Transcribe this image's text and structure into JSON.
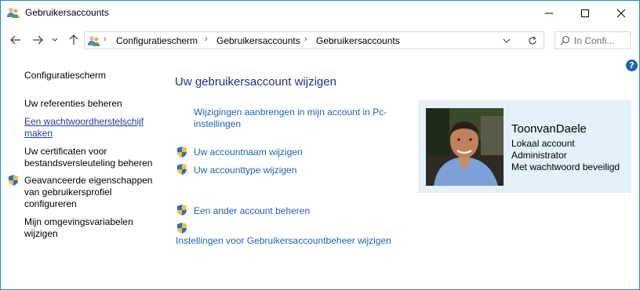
{
  "window": {
    "title": "Gebruikersaccounts"
  },
  "address_bar": {
    "breadcrumbs": [
      "Configuratiescherm",
      "Gebruikersaccounts",
      "Gebruikersaccounts"
    ],
    "search_placeholder": "In Confi..."
  },
  "sidebar": {
    "items": [
      {
        "label": "Configuratiescherm"
      },
      {
        "label": "Uw referenties beheren"
      },
      {
        "label": "Een wachtwoordherstelschijf maken"
      },
      {
        "label": "Uw certificaten voor bestandsversleuteling beheren"
      },
      {
        "label": "Geavanceerde eigenschappen van gebruikersprofiel configureren"
      },
      {
        "label": "Mijn omgevingsvariabelen wijzigen"
      }
    ]
  },
  "main": {
    "title": "Uw gebruikersaccount wijzigen",
    "links": [
      {
        "label": "Wijzigingen aanbrengen in mijn account in Pc-instellingen"
      },
      {
        "label": "Uw accountnaam wijzigen"
      },
      {
        "label": "Uw accounttype wijzigen"
      },
      {
        "label": "Een ander account beheren"
      },
      {
        "label": "Instellingen voor Gebruikersaccountbeheer wijzigen"
      }
    ]
  },
  "account": {
    "name": "ToonvanDaele",
    "details": [
      "Lokaal account",
      "Administrator",
      "Met wachtwoord beveiligd"
    ]
  },
  "colors": {
    "link": "#1e64b4",
    "heading": "#1e3287",
    "panel_bg": "#e4f1fb",
    "border": "#1a8ad4"
  }
}
